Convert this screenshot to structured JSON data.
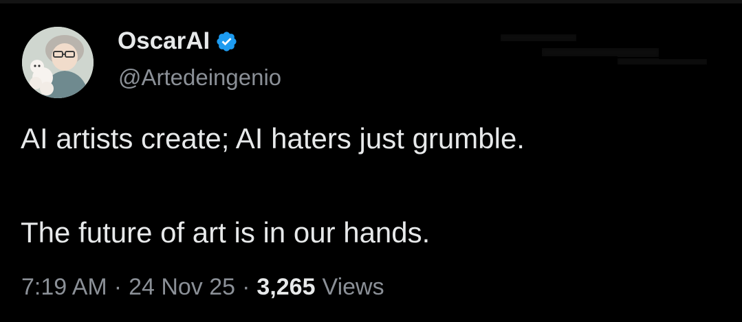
{
  "author": {
    "display_name": "OscarAI",
    "handle": "@Artedeingenio",
    "verified": true,
    "verified_color": "#1d9bf0"
  },
  "tweet": {
    "lines": [
      "AI artists create; AI haters just grumble.",
      "The future of art is in our hands."
    ]
  },
  "meta": {
    "time": "7:19 AM",
    "separator": "·",
    "date": "24 Nov 25",
    "views_count": "3,265",
    "views_label": "Views"
  },
  "icons": {
    "avatar": "avatar-image",
    "verified": "verified-badge-icon"
  },
  "colors": {
    "background": "#000000",
    "primary_text": "#e7e9ea",
    "secondary_text": "#8b9097"
  }
}
